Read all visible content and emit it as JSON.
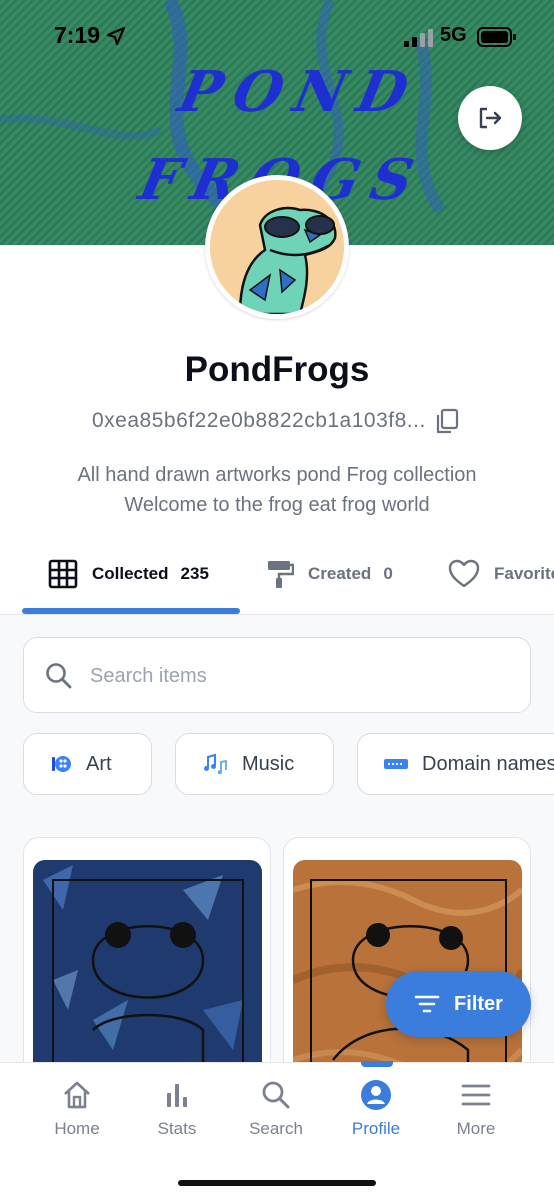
{
  "status_bar": {
    "time": "7:19",
    "network": "5G"
  },
  "banner": {
    "title_line1": "POND",
    "title_line2": "FROGS"
  },
  "profile": {
    "name": "PondFrogs",
    "address": "0xea85b6f22e0b8822cb1a103f8...",
    "bio_line1": "All hand drawn artworks pond Frog collection",
    "bio_line2": "Welcome to the frog eat frog world"
  },
  "tabs": [
    {
      "label": "Collected",
      "count": "235",
      "active": true
    },
    {
      "label": "Created",
      "count": "0",
      "active": false
    },
    {
      "label": "Favorites",
      "count": "",
      "active": false
    }
  ],
  "search": {
    "placeholder": "Search items"
  },
  "chips": [
    {
      "label": "Art",
      "icon": "art-icon"
    },
    {
      "label": "Music",
      "icon": "music-icon"
    },
    {
      "label": "Domain names",
      "icon": "domain-icon"
    }
  ],
  "filter_button": {
    "label": "Filter"
  },
  "bottom_nav": [
    {
      "label": "Home",
      "icon": "home-icon"
    },
    {
      "label": "Stats",
      "icon": "stats-icon"
    },
    {
      "label": "Search",
      "icon": "search-icon"
    },
    {
      "label": "Profile",
      "icon": "profile-icon",
      "active": true
    },
    {
      "label": "More",
      "icon": "menu-icon"
    }
  ],
  "colors": {
    "accent": "#3b7ddd",
    "banner_green": "#2e7d5b",
    "banner_text": "#1d2fd1",
    "avatar_bg": "#f7d29f"
  }
}
